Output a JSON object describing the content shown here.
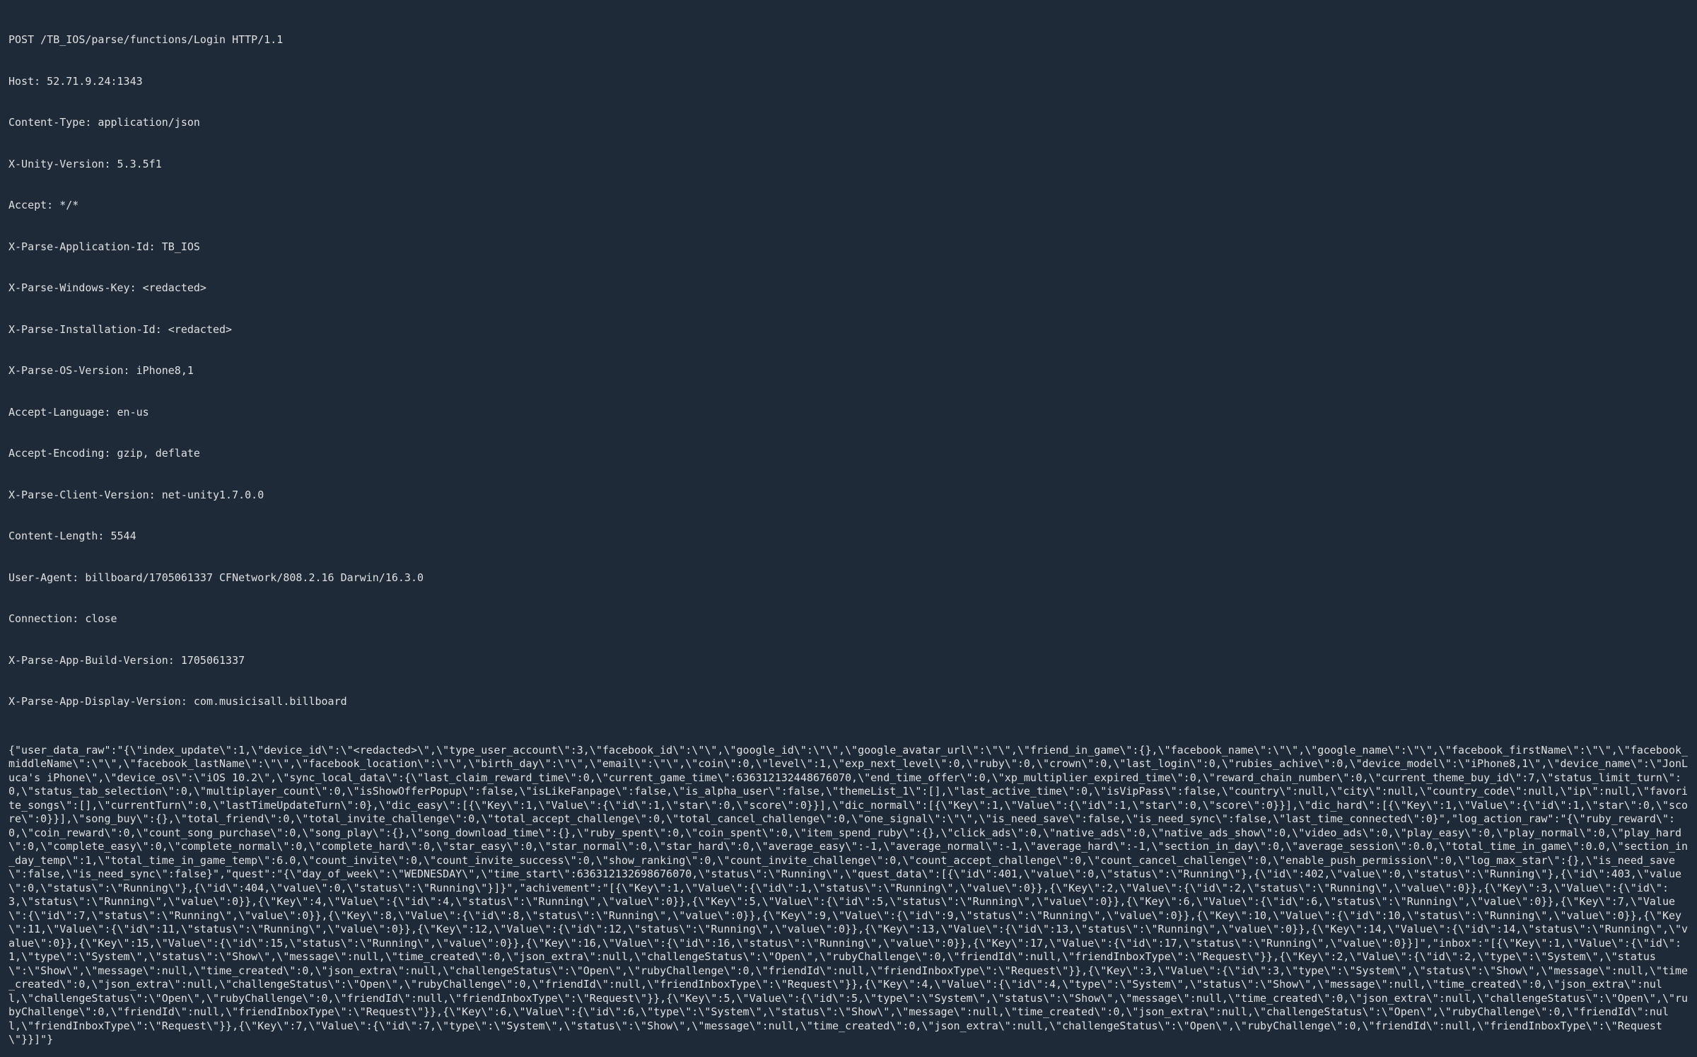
{
  "http_headers": {
    "request_line": "POST /TB_IOS/parse/functions/Login HTTP/1.1",
    "host": "Host: 52.71.9.24:1343",
    "content_type": "Content-Type: application/json",
    "x_unity_version": "X-Unity-Version: 5.3.5f1",
    "accept": "Accept: */*",
    "x_parse_app_id": "X-Parse-Application-Id: TB_IOS",
    "x_parse_windows_key": "X-Parse-Windows-Key: <redacted>",
    "x_parse_installation_id": "X-Parse-Installation-Id: <redacted>",
    "x_parse_os_version": "X-Parse-OS-Version: iPhone8,1",
    "accept_language": "Accept-Language: en-us",
    "accept_encoding": "Accept-Encoding: gzip, deflate",
    "x_parse_client_version": "X-Parse-Client-Version: net-unity1.7.0.0",
    "content_length": "Content-Length: 5544",
    "user_agent": "User-Agent: billboard/1705061337 CFNetwork/808.2.16 Darwin/16.3.0",
    "connection": "Connection: close",
    "x_parse_app_build_version": "X-Parse-App-Build-Version: 1705061337",
    "x_parse_app_display_version": "X-Parse-App-Display-Version: com.musicisall.billboard"
  },
  "body_text": "{\"user_data_raw\":\"{\\\"index_update\\\":1,\\\"device_id\\\":\\\"<redacted>\\\",\\\"type_user_account\\\":3,\\\"facebook_id\\\":\\\"\\\",\\\"google_id\\\":\\\"\\\",\\\"google_avatar_url\\\":\\\"\\\",\\\"friend_in_game\\\":{},\\\"facebook_name\\\":\\\"\\\",\\\"google_name\\\":\\\"\\\",\\\"facebook_firstName\\\":\\\"\\\",\\\"facebook_middleName\\\":\\\"\\\",\\\"facebook_lastName\\\":\\\"\\\",\\\"facebook_location\\\":\\\"\\\",\\\"birth_day\\\":\\\"\\\",\\\"email\\\":\\\"\\\",\\\"coin\\\":0,\\\"level\\\":1,\\\"exp_next_level\\\":0,\\\"ruby\\\":0,\\\"crown\\\":0,\\\"last_login\\\":0,\\\"rubies_achive\\\":0,\\\"device_model\\\":\\\"iPhone8,1\\\",\\\"device_name\\\":\\\"JonLuca's iPhone\\\",\\\"device_os\\\":\\\"iOS 10.2\\\",\\\"sync_local_data\\\":{\\\"last_claim_reward_time\\\":0,\\\"current_game_time\\\":636312132448676070,\\\"end_time_offer\\\":0,\\\"xp_multiplier_expired_time\\\":0,\\\"reward_chain_number\\\":0,\\\"current_theme_buy_id\\\":7,\\\"status_limit_turn\\\":0,\\\"status_tab_selection\\\":0,\\\"multiplayer_count\\\":0,\\\"isShowOfferPopup\\\":false,\\\"isLikeFanpage\\\":false,\\\"is_alpha_user\\\":false,\\\"themeList_1\\\":[],\\\"last_active_time\\\":0,\\\"isVipPass\\\":false,\\\"country\\\":null,\\\"city\\\":null,\\\"country_code\\\":null,\\\"ip\\\":null,\\\"favorite_songs\\\":[],\\\"currentTurn\\\":0,\\\"lastTimeUpdateTurn\\\":0},\\\"dic_easy\\\":[{\\\"Key\\\":1,\\\"Value\\\":{\\\"id\\\":1,\\\"star\\\":0,\\\"score\\\":0}}],\\\"dic_normal\\\":[{\\\"Key\\\":1,\\\"Value\\\":{\\\"id\\\":1,\\\"star\\\":0,\\\"score\\\":0}}],\\\"dic_hard\\\":[{\\\"Key\\\":1,\\\"Value\\\":{\\\"id\\\":1,\\\"star\\\":0,\\\"score\\\":0}}],\\\"song_buy\\\":{},\\\"total_friend\\\":0,\\\"total_invite_challenge\\\":0,\\\"total_accept_challenge\\\":0,\\\"total_cancel_challenge\\\":0,\\\"one_signal\\\":\\\"\\\",\\\"is_need_save\\\":false,\\\"is_need_sync\\\":false,\\\"last_time_connected\\\":0}\",\"log_action_raw\":\"{\\\"ruby_reward\\\":0,\\\"coin_reward\\\":0,\\\"count_song_purchase\\\":0,\\\"song_play\\\":{},\\\"song_download_time\\\":{},\\\"ruby_spent\\\":0,\\\"coin_spent\\\":0,\\\"item_spend_ruby\\\":{},\\\"click_ads\\\":0,\\\"native_ads\\\":0,\\\"native_ads_show\\\":0,\\\"video_ads\\\":0,\\\"play_easy\\\":0,\\\"play_normal\\\":0,\\\"play_hard\\\":0,\\\"complete_easy\\\":0,\\\"complete_normal\\\":0,\\\"complete_hard\\\":0,\\\"star_easy\\\":0,\\\"star_normal\\\":0,\\\"star_hard\\\":0,\\\"average_easy\\\":-1,\\\"average_normal\\\":-1,\\\"average_hard\\\":-1,\\\"section_in_day\\\":0,\\\"average_session\\\":0.0,\\\"total_time_in_game\\\":0.0,\\\"section_in_day_temp\\\":1,\\\"total_time_in_game_temp\\\":6.0,\\\"count_invite\\\":0,\\\"count_invite_success\\\":0,\\\"show_ranking\\\":0,\\\"count_invite_challenge\\\":0,\\\"count_accept_challenge\\\":0,\\\"count_cancel_challenge\\\":0,\\\"enable_push_permission\\\":0,\\\"log_max_star\\\":{},\\\"is_need_save\\\":false,\\\"is_need_sync\\\":false}\",\"quest\":\"{\\\"day_of_week\\\":\\\"WEDNESDAY\\\",\\\"time_start\\\":636312132698676070,\\\"status\\\":\\\"Running\\\",\\\"quest_data\\\":[{\\\"id\\\":401,\\\"value\\\":0,\\\"status\\\":\\\"Running\\\"},{\\\"id\\\":402,\\\"value\\\":0,\\\"status\\\":\\\"Running\\\"},{\\\"id\\\":403,\\\"value\\\":0,\\\"status\\\":\\\"Running\\\"},{\\\"id\\\":404,\\\"value\\\":0,\\\"status\\\":\\\"Running\\\"}]}\",\"achivement\":\"[{\\\"Key\\\":1,\\\"Value\\\":{\\\"id\\\":1,\\\"status\\\":\\\"Running\\\",\\\"value\\\":0}},{\\\"Key\\\":2,\\\"Value\\\":{\\\"id\\\":2,\\\"status\\\":\\\"Running\\\",\\\"value\\\":0}},{\\\"Key\\\":3,\\\"Value\\\":{\\\"id\\\":3,\\\"status\\\":\\\"Running\\\",\\\"value\\\":0}},{\\\"Key\\\":4,\\\"Value\\\":{\\\"id\\\":4,\\\"status\\\":\\\"Running\\\",\\\"value\\\":0}},{\\\"Key\\\":5,\\\"Value\\\":{\\\"id\\\":5,\\\"status\\\":\\\"Running\\\",\\\"value\\\":0}},{\\\"Key\\\":6,\\\"Value\\\":{\\\"id\\\":6,\\\"status\\\":\\\"Running\\\",\\\"value\\\":0}},{\\\"Key\\\":7,\\\"Value\\\":{\\\"id\\\":7,\\\"status\\\":\\\"Running\\\",\\\"value\\\":0}},{\\\"Key\\\":8,\\\"Value\\\":{\\\"id\\\":8,\\\"status\\\":\\\"Running\\\",\\\"value\\\":0}},{\\\"Key\\\":9,\\\"Value\\\":{\\\"id\\\":9,\\\"status\\\":\\\"Running\\\",\\\"value\\\":0}},{\\\"Key\\\":10,\\\"Value\\\":{\\\"id\\\":10,\\\"status\\\":\\\"Running\\\",\\\"value\\\":0}},{\\\"Key\\\":11,\\\"Value\\\":{\\\"id\\\":11,\\\"status\\\":\\\"Running\\\",\\\"value\\\":0}},{\\\"Key\\\":12,\\\"Value\\\":{\\\"id\\\":12,\\\"status\\\":\\\"Running\\\",\\\"value\\\":0}},{\\\"Key\\\":13,\\\"Value\\\":{\\\"id\\\":13,\\\"status\\\":\\\"Running\\\",\\\"value\\\":0}},{\\\"Key\\\":14,\\\"Value\\\":{\\\"id\\\":14,\\\"status\\\":\\\"Running\\\",\\\"value\\\":0}},{\\\"Key\\\":15,\\\"Value\\\":{\\\"id\\\":15,\\\"status\\\":\\\"Running\\\",\\\"value\\\":0}},{\\\"Key\\\":16,\\\"Value\\\":{\\\"id\\\":16,\\\"status\\\":\\\"Running\\\",\\\"value\\\":0}},{\\\"Key\\\":17,\\\"Value\\\":{\\\"id\\\":17,\\\"status\\\":\\\"Running\\\",\\\"value\\\":0}}]\",\"inbox\":\"[{\\\"Key\\\":1,\\\"Value\\\":{\\\"id\\\":1,\\\"type\\\":\\\"System\\\",\\\"status\\\":\\\"Show\\\",\\\"message\\\":null,\\\"time_created\\\":0,\\\"json_extra\\\":null,\\\"challengeStatus\\\":\\\"Open\\\",\\\"rubyChallenge\\\":0,\\\"friendId\\\":null,\\\"friendInboxType\\\":\\\"Request\\\"}},{\\\"Key\\\":2,\\\"Value\\\":{\\\"id\\\":2,\\\"type\\\":\\\"System\\\",\\\"status\\\":\\\"Show\\\",\\\"message\\\":null,\\\"time_created\\\":0,\\\"json_extra\\\":null,\\\"challengeStatus\\\":\\\"Open\\\",\\\"rubyChallenge\\\":0,\\\"friendId\\\":null,\\\"friendInboxType\\\":\\\"Request\\\"}},{\\\"Key\\\":3,\\\"Value\\\":{\\\"id\\\":3,\\\"type\\\":\\\"System\\\",\\\"status\\\":\\\"Show\\\",\\\"message\\\":null,\\\"time_created\\\":0,\\\"json_extra\\\":null,\\\"challengeStatus\\\":\\\"Open\\\",\\\"rubyChallenge\\\":0,\\\"friendId\\\":null,\\\"friendInboxType\\\":\\\"Request\\\"}},{\\\"Key\\\":4,\\\"Value\\\":{\\\"id\\\":4,\\\"type\\\":\\\"System\\\",\\\"status\\\":\\\"Show\\\",\\\"message\\\":null,\\\"time_created\\\":0,\\\"json_extra\\\":null,\\\"challengeStatus\\\":\\\"Open\\\",\\\"rubyChallenge\\\":0,\\\"friendId\\\":null,\\\"friendInboxType\\\":\\\"Request\\\"}},{\\\"Key\\\":5,\\\"Value\\\":{\\\"id\\\":5,\\\"type\\\":\\\"System\\\",\\\"status\\\":\\\"Show\\\",\\\"message\\\":null,\\\"time_created\\\":0,\\\"json_extra\\\":null,\\\"challengeStatus\\\":\\\"Open\\\",\\\"rubyChallenge\\\":0,\\\"friendId\\\":null,\\\"friendInboxType\\\":\\\"Request\\\"}},{\\\"Key\\\":6,\\\"Value\\\":{\\\"id\\\":6,\\\"type\\\":\\\"System\\\",\\\"status\\\":\\\"Show\\\",\\\"message\\\":null,\\\"time_created\\\":0,\\\"json_extra\\\":null,\\\"challengeStatus\\\":\\\"Open\\\",\\\"rubyChallenge\\\":0,\\\"friendId\\\":null,\\\"friendInboxType\\\":\\\"Request\\\"}},{\\\"Key\\\":7,\\\"Value\\\":{\\\"id\\\":7,\\\"type\\\":\\\"System\\\",\\\"status\\\":\\\"Show\\\",\\\"message\\\":null,\\\"time_created\\\":0,\\\"json_extra\\\":null,\\\"challengeStatus\\\":\\\"Open\\\",\\\"rubyChallenge\\\":0,\\\"friendId\\\":null,\\\"friendInboxType\\\":\\\"Request\\\"}}]\"}"
}
